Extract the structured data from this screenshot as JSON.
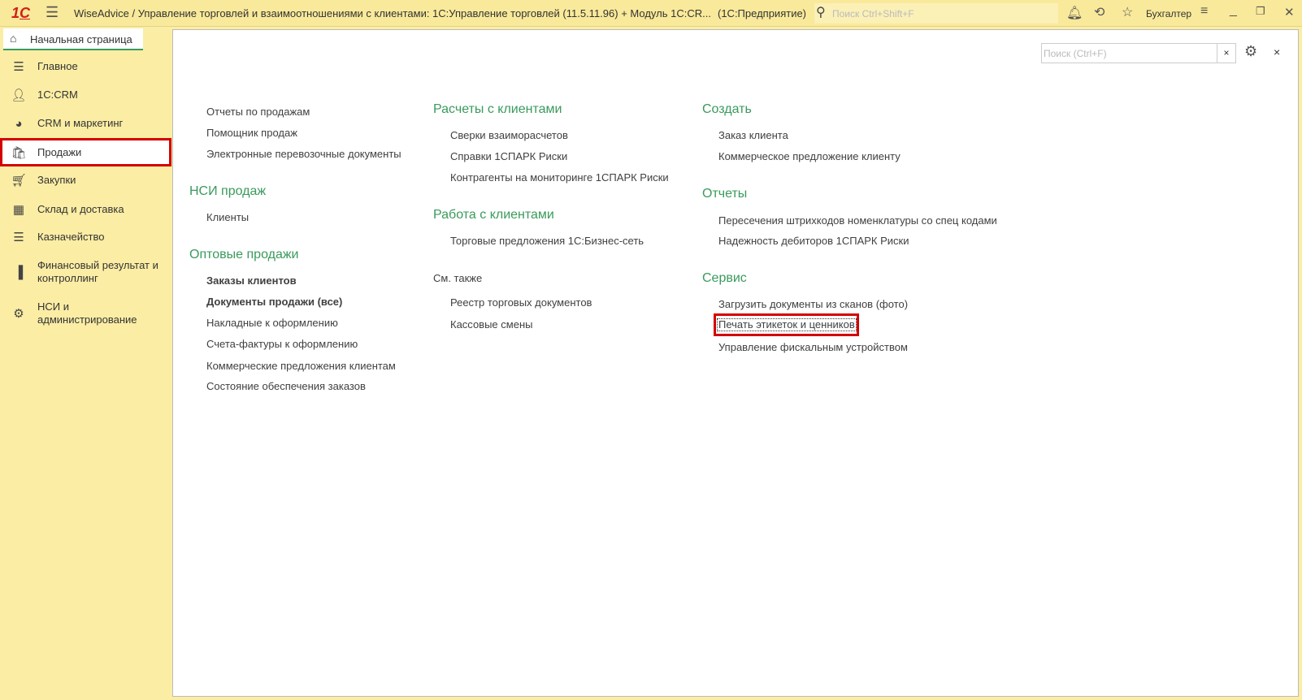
{
  "titlebar": {
    "title": "WiseAdvice / Управление торговлей и взаимоотношениями с клиентами: 1С:Управление торговлей (11.5.11.96) + Модуль 1С:CR...",
    "platform": "(1С:Предприятие)",
    "search_placeholder": "Поиск Ctrl+Shift+F",
    "user": "Бухгалтер"
  },
  "home_tab": {
    "label": "Начальная страница"
  },
  "sidebar": {
    "items": [
      {
        "label": "Главное",
        "icon": "menu-icon"
      },
      {
        "label": "1С:CRM",
        "icon": "users-icon"
      },
      {
        "label": "CRM и маркетинг",
        "icon": "pie-chart-icon"
      },
      {
        "label": "Продажи",
        "icon": "shopping-bag-icon",
        "selected": true
      },
      {
        "label": "Закупки",
        "icon": "cart-icon"
      },
      {
        "label": "Склад и доставка",
        "icon": "warehouse-icon"
      },
      {
        "label": "Казначейство",
        "icon": "coins-icon"
      },
      {
        "label": "Финансовый результат и контроллинг",
        "icon": "bar-chart-icon"
      },
      {
        "label": "НСИ и администрирование",
        "icon": "gear-icon"
      }
    ]
  },
  "content": {
    "search_placeholder": "Поиск (Ctrl+F)",
    "col1": {
      "top_items": [
        "Отчеты по продажам",
        "Помощник продаж",
        "Электронные перевозочные документы"
      ],
      "nsi_heading": "НСИ продаж",
      "nsi_items": [
        "Клиенты"
      ],
      "wholesale_heading": "Оптовые продажи",
      "wholesale_items": [
        "Заказы клиентов",
        "Документы продажи (все)",
        "Накладные к оформлению",
        "Счета-фактуры к оформлению",
        "Коммерческие предложения клиентам",
        "Состояние обеспечения заказов"
      ]
    },
    "col2": {
      "settlements_heading": "Расчеты с клиентами",
      "settlements_items": [
        "Сверки взаиморасчетов",
        "Справки 1СПАРК Риски",
        "Контрагенты на мониторинге 1СПАРК Риски"
      ],
      "work_heading": "Работа с клиентами",
      "work_items": [
        "Торговые предложения 1С:Бизнес-сеть"
      ],
      "see_also": "См. также",
      "see_also_items": [
        "Реестр торговых документов",
        "Кассовые смены"
      ]
    },
    "col3": {
      "create_heading": "Создать",
      "create_items": [
        "Заказ клиента",
        "Коммерческое предложение клиенту"
      ],
      "reports_heading": "Отчеты",
      "reports_items": [
        "Пересечения штрихкодов номенклатуры со спец кодами",
        "Надежность дебиторов 1СПАРК Риски"
      ],
      "service_heading": "Сервис",
      "service_items": [
        "Загрузить документы из сканов (фото)",
        "Печать этикеток и ценников",
        "Управление фискальным устройством"
      ]
    }
  },
  "colors": {
    "accent_green": "#3a9a5c",
    "highlight_red": "#d40000",
    "panel_yellow": "#fbeda4"
  }
}
